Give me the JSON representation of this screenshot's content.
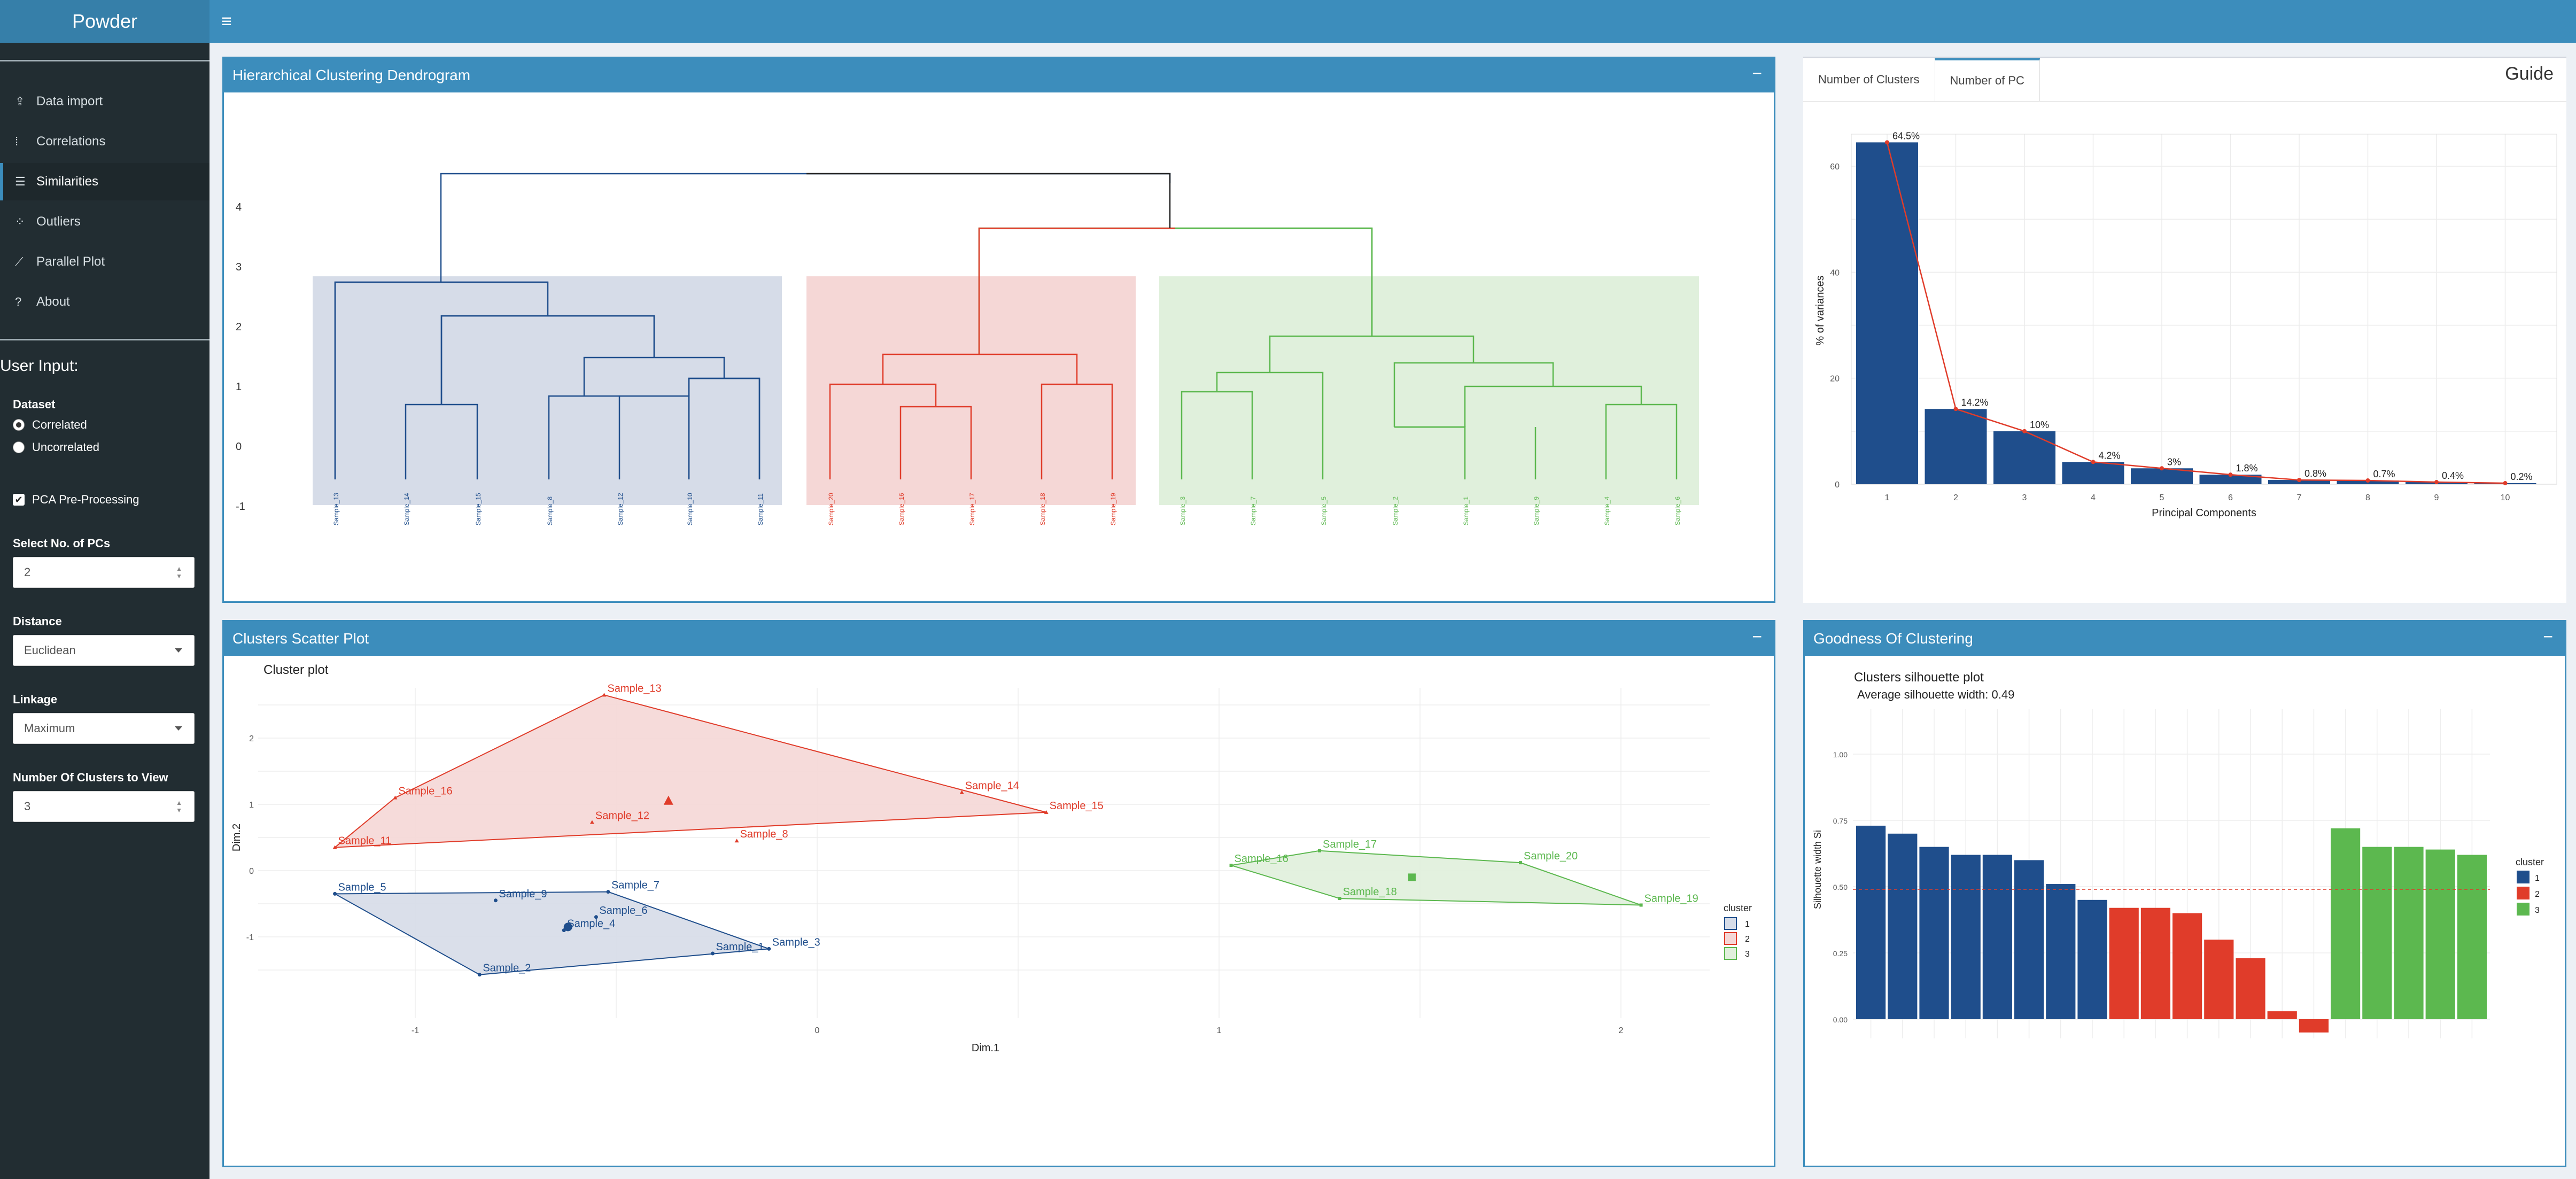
{
  "app": {
    "title": "Powder"
  },
  "sidebar": {
    "menu": [
      {
        "label": "Data import",
        "icon": "upload-icon",
        "glyph": "⇪"
      },
      {
        "label": "Correlations",
        "icon": "grid-icon",
        "glyph": "⁞"
      },
      {
        "label": "Similarities",
        "icon": "list-icon",
        "glyph": "☰"
      },
      {
        "label": "Outliers",
        "icon": "scatter-icon",
        "glyph": "⁘"
      },
      {
        "label": "Parallel Plot",
        "icon": "line-chart-icon",
        "glyph": "⟋"
      },
      {
        "label": "About",
        "icon": "question-icon",
        "glyph": "?"
      }
    ],
    "user_input_title": "User Input:",
    "dataset_label": "Dataset",
    "dataset_options": [
      "Correlated",
      "Uncorrelated"
    ],
    "dataset_selected": "Correlated",
    "pca_label": "PCA Pre-Processing",
    "pca_checked": true,
    "pcs_label": "Select No. of PCs",
    "pcs_value": "2",
    "distance_label": "Distance",
    "distance_value": "Euclidean",
    "linkage_label": "Linkage",
    "linkage_value": "Maximum",
    "clusters_label": "Number Of Clusters to View",
    "clusters_value": "3"
  },
  "panels": {
    "dendrogram_title": "Hierarchical Clustering Dendrogram",
    "scatter_title": "Clusters Scatter Plot",
    "goodness_title": "Goodness Of Clustering",
    "tabs": [
      "Number of Clusters",
      "Number of PC"
    ],
    "active_tab": "Number of PC",
    "guide_label": "Guide",
    "minimize_glyph": "−"
  },
  "colors": {
    "blue": "#1f4e8c",
    "red": "#e03c2a",
    "green": "#5cb84f",
    "blue_fill": "#d6dce8",
    "red_fill": "#f5d7d6",
    "green_fill": "#e0f0dc"
  },
  "chart_data": [
    {
      "type": "dendrogram",
      "y_ticks": [
        "4",
        "3",
        "2",
        "1",
        "0",
        "-1"
      ],
      "leaves": [
        {
          "label": "Sample_13",
          "cluster": 1
        },
        {
          "label": "Sample_14",
          "cluster": 1
        },
        {
          "label": "Sample_15",
          "cluster": 1
        },
        {
          "label": "Sample_8",
          "cluster": 1
        },
        {
          "label": "Sample_12",
          "cluster": 1
        },
        {
          "label": "Sample_10",
          "cluster": 1
        },
        {
          "label": "Sample_11",
          "cluster": 1
        },
        {
          "label": "Sample_20",
          "cluster": 2
        },
        {
          "label": "Sample_16",
          "cluster": 2
        },
        {
          "label": "Sample_17",
          "cluster": 2
        },
        {
          "label": "Sample_18",
          "cluster": 2
        },
        {
          "label": "Sample_19",
          "cluster": 2
        },
        {
          "label": "Sample_3",
          "cluster": 3
        },
        {
          "label": "Sample_7",
          "cluster": 3
        },
        {
          "label": "Sample_5",
          "cluster": 3
        },
        {
          "label": "Sample_2",
          "cluster": 3
        },
        {
          "label": "Sample_1",
          "cluster": 3
        },
        {
          "label": "Sample_9",
          "cluster": 3
        },
        {
          "label": "Sample_4",
          "cluster": 3
        },
        {
          "label": "Sample_6",
          "cluster": 3
        }
      ],
      "ylim": [
        -1,
        4.3
      ]
    },
    {
      "type": "bar",
      "categories": [
        "1",
        "2",
        "3",
        "4",
        "5",
        "6",
        "7",
        "8",
        "9",
        "10"
      ],
      "values": [
        64.5,
        14.2,
        10,
        4.2,
        3,
        1.8,
        0.8,
        0.7,
        0.4,
        0.2
      ],
      "labels": [
        "64.5%",
        "14.2%",
        "10%",
        "4.2%",
        "3%",
        "1.8%",
        "0.8%",
        "0.7%",
        "0.4%",
        "0.2%"
      ],
      "xlabel": "Principal Components",
      "ylabel": "% of variances",
      "y_ticks": [
        0,
        20,
        40,
        60
      ],
      "ylim": [
        0,
        68
      ],
      "line": true
    },
    {
      "type": "scatter",
      "title": "Cluster plot",
      "xlabel": "Dim.1",
      "ylabel": "Dim.2",
      "x_ticks": [
        -1,
        0,
        1,
        2
      ],
      "y_ticks": [
        -1,
        0,
        1,
        2
      ],
      "xlim": [
        -1.45,
        2.22
      ],
      "ylim": [
        -1.6,
        2.6
      ],
      "legend_title": "cluster",
      "legend": [
        "1",
        "2",
        "3"
      ],
      "points": [
        {
          "label": "Sample_5",
          "x": -1.2,
          "y": -0.35,
          "cluster": 1
        },
        {
          "label": "Sample_7",
          "x": -0.52,
          "y": -0.32,
          "cluster": 1
        },
        {
          "label": "Sample_9",
          "x": -0.8,
          "y": -0.45,
          "cluster": 1
        },
        {
          "label": "Sample_6",
          "x": -0.55,
          "y": -0.7,
          "cluster": 1
        },
        {
          "label": "Sample_4",
          "x": -0.63,
          "y": -0.9,
          "cluster": 1
        },
        {
          "label": "Sample_3",
          "x": -0.12,
          "y": -1.18,
          "cluster": 1
        },
        {
          "label": "Sample_1",
          "x": -0.26,
          "y": -1.25,
          "cluster": 1
        },
        {
          "label": "Sample_2",
          "x": -0.84,
          "y": -1.57,
          "cluster": 1
        },
        {
          "label": "Sample_13",
          "x": -0.53,
          "y": 2.65,
          "cluster": 2
        },
        {
          "label": "Sample_14",
          "x": 0.36,
          "y": 1.18,
          "cluster": 2
        },
        {
          "label": "Sample_15",
          "x": 0.57,
          "y": 0.88,
          "cluster": 2
        },
        {
          "label": "Sample_16",
          "x": -1.05,
          "y": 1.1,
          "cluster": 2
        },
        {
          "label": "Sample_12",
          "x": -0.56,
          "y": 0.73,
          "cluster": 2
        },
        {
          "label": "Sample_8",
          "x": -0.2,
          "y": 0.45,
          "cluster": 2
        },
        {
          "label": "Sample_11",
          "x": -1.2,
          "y": 0.35,
          "cluster": 2
        },
        {
          "label": "Sample_16",
          "x": 1.03,
          "y": 0.08,
          "cluster": 3
        },
        {
          "label": "Sample_17",
          "x": 1.25,
          "y": 0.3,
          "cluster": 3
        },
        {
          "label": "Sample_20",
          "x": 1.75,
          "y": 0.12,
          "cluster": 3
        },
        {
          "label": "Sample_18",
          "x": 1.3,
          "y": -0.42,
          "cluster": 3
        },
        {
          "label": "Sample_19",
          "x": 2.05,
          "y": -0.52,
          "cluster": 3
        }
      ],
      "centers": [
        {
          "x": -0.62,
          "y": -0.85,
          "cluster": 1
        },
        {
          "x": -0.37,
          "y": 1.05,
          "cluster": 2
        },
        {
          "x": 1.48,
          "y": -0.1,
          "cluster": 3
        }
      ],
      "hulls": [
        [
          "Sample_5",
          "Sample_7",
          "Sample_3",
          "Sample_2"
        ],
        [
          "Sample_13",
          "Sample_15",
          "Sample_11",
          "Sample_16"
        ],
        [
          "Sample_16",
          "Sample_17",
          "Sample_20",
          "Sample_19",
          "Sample_18"
        ]
      ]
    },
    {
      "type": "bar",
      "title": "Clusters silhouette plot",
      "subtitle": "Average silhouette width: 0.49",
      "ylabel": "Silhouette width Si",
      "y_ticks": [
        "0.00",
        "0.25",
        "0.50",
        "0.75",
        "1.00"
      ],
      "ylim": [
        -0.06,
        1.0
      ],
      "average": 0.49,
      "legend_title": "cluster",
      "legend": [
        "1",
        "2",
        "3"
      ],
      "values": [
        0.73,
        0.7,
        0.65,
        0.62,
        0.62,
        0.6,
        0.51,
        0.45,
        0.42,
        0.42,
        0.4,
        0.3,
        0.23,
        0.03,
        -0.05,
        0.72,
        0.65,
        0.65,
        0.64,
        0.62
      ],
      "clusters": [
        1,
        1,
        1,
        1,
        1,
        1,
        1,
        1,
        2,
        2,
        2,
        2,
        2,
        2,
        2,
        3,
        3,
        3,
        3,
        3
      ]
    }
  ]
}
